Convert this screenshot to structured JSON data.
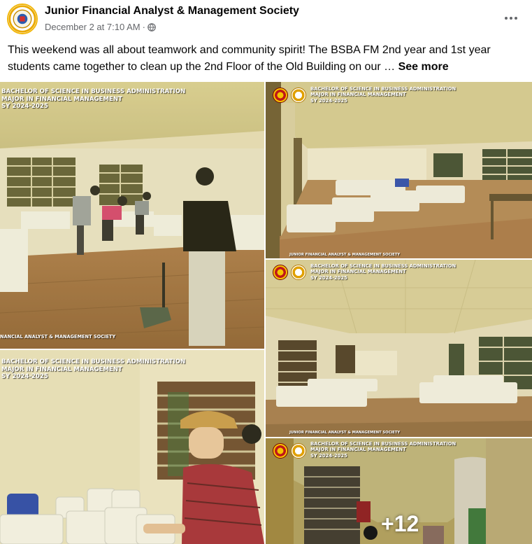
{
  "post": {
    "author": "Junior Financial Analyst & Management Society",
    "date": "December 2 at 7:10 AM",
    "separator": "·",
    "text": "This weekend was all about teamwork and community spirit! The BSBA FM 2nd year and 1st year students came together to clean up the 2nd Floor of the Old Building on our …",
    "see_more": "See more"
  },
  "icons": {
    "avatar": "society-logo",
    "privacy": "globe-icon",
    "menu": "more-options-icon"
  },
  "photos": {
    "caption_line1": "BACHELOR OF SCIENCE IN BUSINESS ADMINISTRATION",
    "caption_line2": "MAJOR IN FINANCIAL MANAGEMENT",
    "caption_line3": "SY 2024-2025",
    "footer_full": "JUNIOR FINANCIAL ANALYST & MANAGEMENT SOCIETY",
    "footer_cropped": "NANCIAL ANALYST & MANAGEMENT SOCIETY",
    "more_count": "+12"
  },
  "colors": {
    "gold_tint": "#d8c640",
    "text_primary": "#050505",
    "text_secondary": "#65676b"
  }
}
